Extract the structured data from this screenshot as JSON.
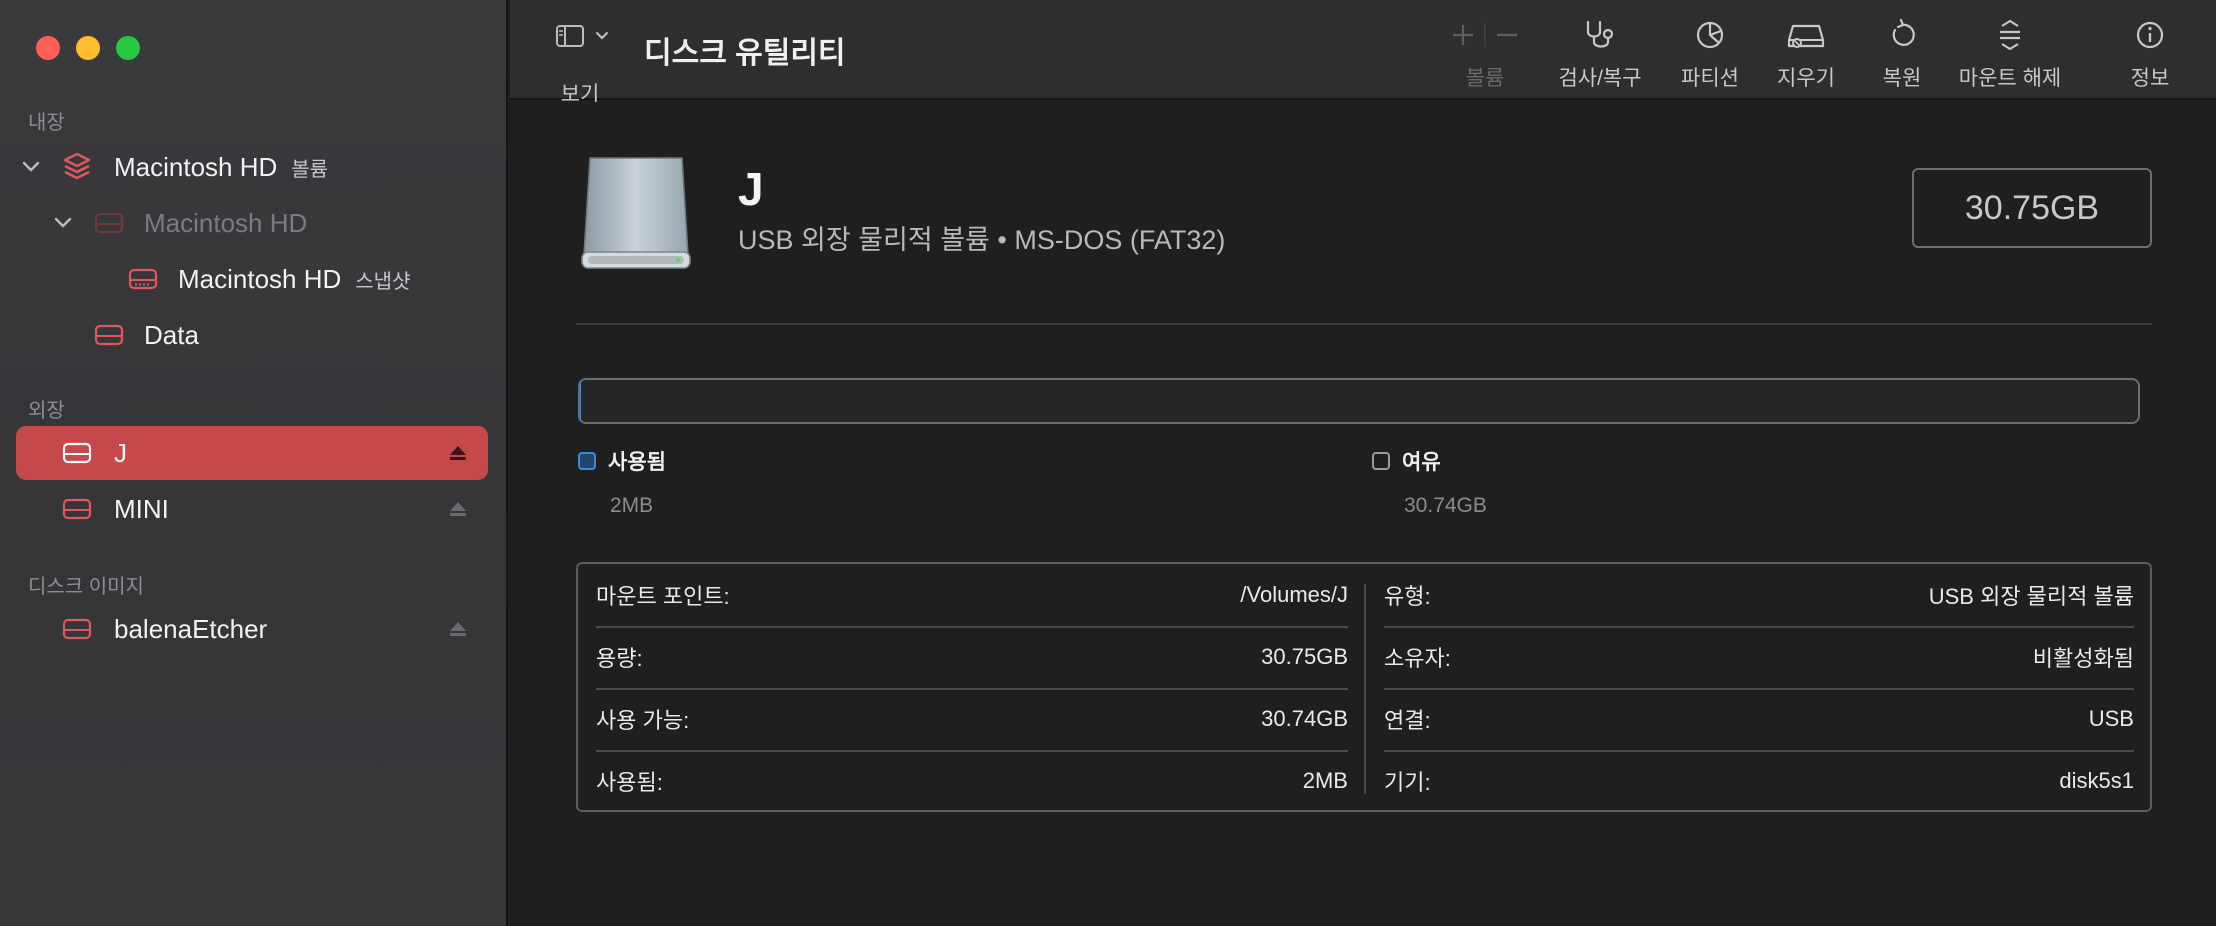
{
  "sidebar": {
    "section_internal": "내장",
    "section_external": "외장",
    "section_images": "디스크 이미지",
    "items": [
      {
        "label": "Macintosh HD",
        "sub": "볼륨"
      },
      {
        "label": "Macintosh HD"
      },
      {
        "label": "Macintosh HD",
        "sub": "스냅샷"
      },
      {
        "label": "Data"
      },
      {
        "label": "J"
      },
      {
        "label": "MINI"
      },
      {
        "label": "balenaEtcher"
      }
    ]
  },
  "toolbar": {
    "view_label": "보기",
    "title": "디스크 유틸리티",
    "volume_label": "볼륨",
    "firstaid_label": "검사/복구",
    "partition_label": "파티션",
    "erase_label": "지우기",
    "restore_label": "복원",
    "unmount_label": "마운트 해제",
    "info_label": "정보"
  },
  "volume": {
    "name": "J",
    "description": "USB 외장 물리적 볼륨 • MS-DOS (FAT32)",
    "capacity": "30.75GB",
    "used_fraction": 0.0001,
    "legend": {
      "used_label": "사용됨",
      "used_value": "2MB",
      "free_label": "여유",
      "free_value": "30.74GB"
    }
  },
  "info": {
    "left": [
      {
        "key": "마운트 포인트:",
        "value": "/Volumes/J"
      },
      {
        "key": "용량:",
        "value": "30.75GB"
      },
      {
        "key": "사용 가능:",
        "value": "30.74GB"
      },
      {
        "key": "사용됨:",
        "value": "2MB"
      }
    ],
    "right": [
      {
        "key": "유형:",
        "value": "USB 외장 물리적 볼륨"
      },
      {
        "key": "소유자:",
        "value": "비활성화됨"
      },
      {
        "key": "연결:",
        "value": "USB"
      },
      {
        "key": "기기:",
        "value": "disk5s1"
      }
    ]
  },
  "colors": {
    "accent_selected": "#c5484a",
    "disk_icon": "#e0585c",
    "used_blue": "#3d8ad9"
  }
}
